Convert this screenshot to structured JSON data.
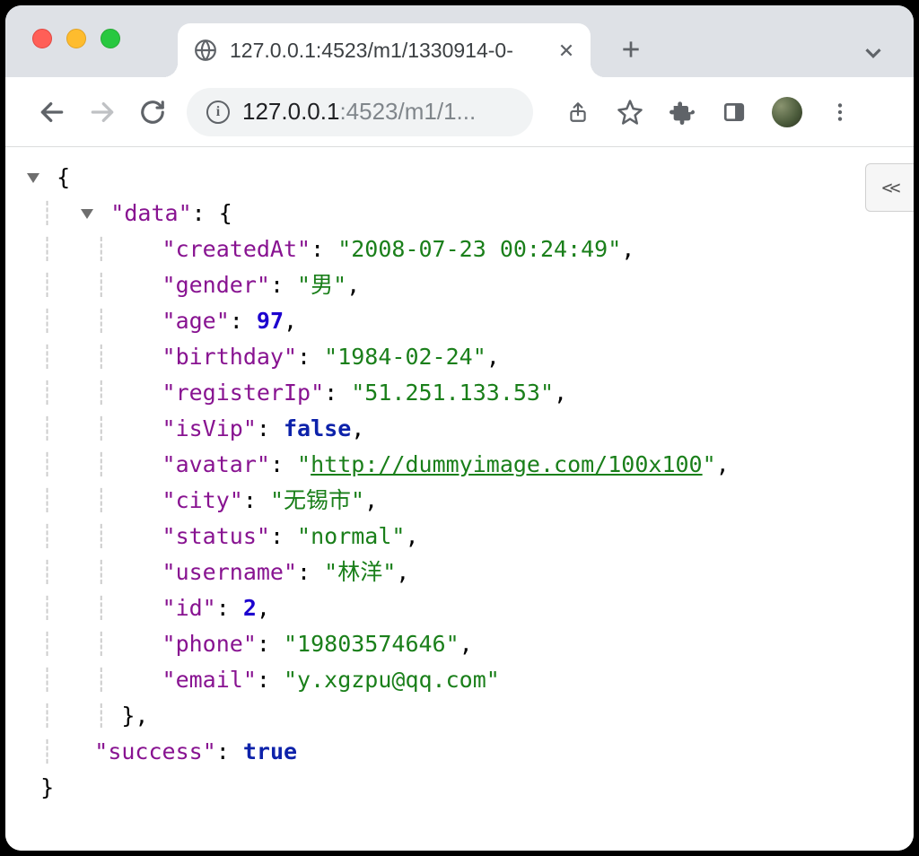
{
  "tab": {
    "title": "127.0.0.1:4523/m1/1330914-0-"
  },
  "omnibox": {
    "host": "127.0.0.1",
    "port_path": ":4523/m1/1..."
  },
  "collapse_label": "<<",
  "json": {
    "data_key": "data",
    "fields": {
      "createdAt": {
        "key": "createdAt",
        "value": "2008-07-23 00:24:49",
        "type": "string"
      },
      "gender": {
        "key": "gender",
        "value": "男",
        "type": "string"
      },
      "age": {
        "key": "age",
        "value": "97",
        "type": "number"
      },
      "birthday": {
        "key": "birthday",
        "value": "1984-02-24",
        "type": "string"
      },
      "registerIp": {
        "key": "registerIp",
        "value": "51.251.133.53",
        "type": "string"
      },
      "isVip": {
        "key": "isVip",
        "value": "false",
        "type": "boolean"
      },
      "avatar": {
        "key": "avatar",
        "value": "http://dummyimage.com/100x100",
        "type": "link"
      },
      "city": {
        "key": "city",
        "value": "无锡市",
        "type": "string"
      },
      "status": {
        "key": "status",
        "value": "normal",
        "type": "string"
      },
      "username": {
        "key": "username",
        "value": "林洋",
        "type": "string"
      },
      "id": {
        "key": "id",
        "value": "2",
        "type": "number"
      },
      "phone": {
        "key": "phone",
        "value": "19803574646",
        "type": "string"
      },
      "email": {
        "key": "email",
        "value": "y.xgzpu@qq.com",
        "type": "string"
      }
    },
    "success_key": "success",
    "success_value": "true"
  }
}
